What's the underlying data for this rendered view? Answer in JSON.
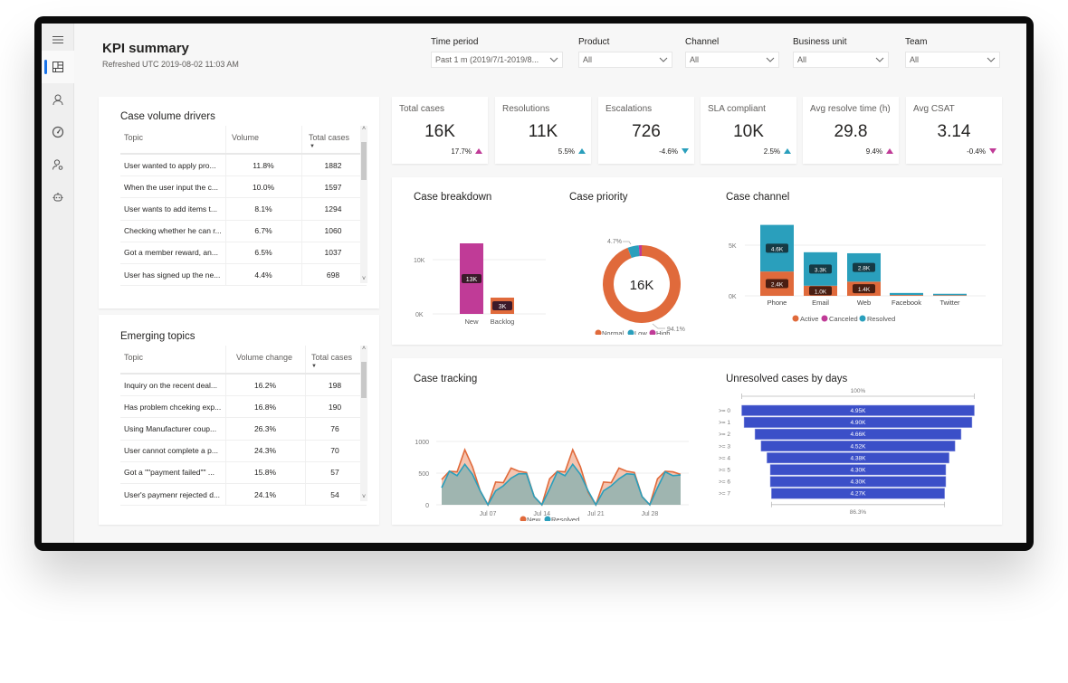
{
  "header": {
    "title": "KPI summary",
    "refreshed": "Refreshed UTC 2019-08-02 11:03 AM"
  },
  "sidebar": {
    "items": [
      {
        "name": "menu-icon",
        "active": false
      },
      {
        "name": "dashboard-icon",
        "active": true
      },
      {
        "name": "person-icon",
        "active": false
      },
      {
        "name": "gauge-icon",
        "active": false
      },
      {
        "name": "person-settings-icon",
        "active": false
      },
      {
        "name": "bot-icon",
        "active": false
      }
    ]
  },
  "filters": [
    {
      "label": "Time period",
      "value": "Past 1 m (2019/7/1-2019/8..."
    },
    {
      "label": "Product",
      "value": "All"
    },
    {
      "label": "Channel",
      "value": "All"
    },
    {
      "label": "Business unit",
      "value": "All"
    },
    {
      "label": "Team",
      "value": "All"
    }
  ],
  "case_volume_drivers": {
    "title": "Case volume drivers",
    "columns": [
      "Topic",
      "Volume",
      "Total cases"
    ],
    "rows": [
      [
        "User wanted to apply pro...",
        "11.8%",
        "1882"
      ],
      [
        "When the user input the c...",
        "10.0%",
        "1597"
      ],
      [
        "User wants to add items t...",
        "8.1%",
        "1294"
      ],
      [
        "Checking whether he can r...",
        "6.7%",
        "1060"
      ],
      [
        "Got a member reward, an...",
        "6.5%",
        "1037"
      ],
      [
        "User has signed up the ne...",
        "4.4%",
        "698"
      ]
    ]
  },
  "emerging_topics": {
    "title": "Emerging topics",
    "columns": [
      "Topic",
      "Volume change",
      "Total cases"
    ],
    "rows": [
      [
        "Inquiry on the recent deal...",
        "16.2%",
        "198"
      ],
      [
        "Has problem chceking exp...",
        "16.8%",
        "190"
      ],
      [
        "Using Manufacturer coup...",
        "26.3%",
        "76"
      ],
      [
        "User cannot complete a p...",
        "24.3%",
        "70"
      ],
      [
        "Got a \"\"payment failed\"\" ...",
        "15.8%",
        "57"
      ],
      [
        "User's paymenr rejected d...",
        "24.1%",
        "54"
      ]
    ]
  },
  "kpis": [
    {
      "label": "Total cases",
      "value": "16K",
      "change": "17.7%",
      "direction": "up",
      "color": "#c03b97"
    },
    {
      "label": "Resolutions",
      "value": "11K",
      "change": "5.5%",
      "direction": "up",
      "color": "#2a9fbc"
    },
    {
      "label": "Escalations",
      "value": "726",
      "change": "-4.6%",
      "direction": "down",
      "color": "#2a9fbc"
    },
    {
      "label": "SLA compliant",
      "value": "10K",
      "change": "2.5%",
      "direction": "up",
      "color": "#2a9fbc"
    },
    {
      "label": "Avg resolve time (h)",
      "value": "29.8",
      "change": "9.4%",
      "direction": "up",
      "color": "#c03b97"
    },
    {
      "label": "Avg CSAT",
      "value": "3.14",
      "change": "-0.4%",
      "direction": "down",
      "color": "#c03b97"
    }
  ],
  "colors": {
    "orange": "#e06a3b",
    "teal": "#2a9fbc",
    "magenta": "#c03b97",
    "funnel": "#3b4fc8",
    "area_fill": "#9fb5b0",
    "new_fill": "#f4c4b0",
    "label_dark": "#3b1a2a"
  },
  "chart_data": [
    {
      "id": "case_breakdown",
      "type": "bar",
      "title": "Case breakdown",
      "categories": [
        "New",
        "Backlog"
      ],
      "values": [
        13000,
        3000
      ],
      "data_labels": [
        "13K",
        "3K"
      ],
      "bar_colors": [
        "#c03b97",
        "#e06a3b"
      ],
      "yticks": [
        "0K",
        "10K"
      ],
      "ylim": [
        0,
        15000
      ],
      "grid": true
    },
    {
      "id": "case_priority",
      "type": "pie",
      "title": "Case priority",
      "center_label": "16K",
      "labels": [
        "Normal",
        "Low",
        "High"
      ],
      "values": [
        94.1,
        4.7,
        1.2
      ],
      "colors": [
        "#e06a3b",
        "#2a9fbc",
        "#c03b97"
      ],
      "data_labels": [
        "94.1%",
        "4.7%"
      ],
      "legend": "bottom"
    },
    {
      "id": "case_channel",
      "type": "bar",
      "stacked": true,
      "title": "Case channel",
      "categories": [
        "Phone",
        "Email",
        "Web",
        "Facebook",
        "Twitter"
      ],
      "series": [
        {
          "name": "Active",
          "color": "#e06a3b",
          "values": [
            2400,
            1000,
            1400,
            80,
            60
          ],
          "labels": [
            "2.4K",
            "1.0K",
            "1.4K",
            "",
            ""
          ]
        },
        {
          "name": "Canceled",
          "color": "#c03b97",
          "values": [
            0,
            0,
            0,
            0,
            0
          ],
          "labels": [
            "",
            "",
            "",
            "",
            ""
          ]
        },
        {
          "name": "Resolved",
          "color": "#2a9fbc",
          "values": [
            4600,
            3300,
            2800,
            200,
            140
          ],
          "labels": [
            "4.6K",
            "3.3K",
            "2.8K",
            "",
            ""
          ]
        }
      ],
      "yticks": [
        "0K",
        "5K"
      ],
      "ylim": [
        0,
        7500
      ],
      "legend": "bottom",
      "grid": true
    },
    {
      "id": "case_tracking",
      "type": "area",
      "title": "Case tracking",
      "x_start": "Jul 01",
      "xticks": [
        "Jul 07",
        "Jul 14",
        "Jul 21",
        "Jul 28"
      ],
      "xtick_index": [
        6,
        13,
        20,
        27
      ],
      "yticks": [
        "0",
        "500",
        "1000"
      ],
      "ylim": [
        0,
        1000
      ],
      "series": [
        {
          "name": "New",
          "color": "#e06a3b",
          "values": [
            400,
            530,
            520,
            870,
            600,
            220,
            0,
            360,
            350,
            580,
            530,
            510,
            130,
            0,
            410,
            530,
            520,
            870,
            600,
            200,
            0,
            360,
            350,
            580,
            530,
            510,
            130,
            0,
            410,
            530,
            520,
            480
          ]
        },
        {
          "name": "Resolved",
          "color": "#2a9fbc",
          "values": [
            270,
            530,
            460,
            640,
            480,
            220,
            0,
            220,
            300,
            420,
            490,
            490,
            130,
            0,
            250,
            520,
            460,
            640,
            480,
            220,
            0,
            220,
            300,
            410,
            490,
            480,
            130,
            0,
            270,
            520,
            460,
            470
          ]
        }
      ],
      "legend": "bottom",
      "grid": true
    },
    {
      "id": "unresolved_by_days",
      "type": "bar",
      "subtype": "funnel",
      "title": "Unresolved cases by days",
      "categories": [
        ">= 0",
        ">= 1",
        ">= 2",
        ">= 3",
        ">= 4",
        ">= 5",
        ">= 6",
        ">= 7"
      ],
      "values": [
        4950,
        4900,
        4660,
        4520,
        4380,
        4300,
        4300,
        4270
      ],
      "data_labels": [
        "4.95K",
        "4.90K",
        "4.66K",
        "4.52K",
        "4.38K",
        "4.30K",
        "4.30K",
        "4.27K"
      ],
      "top_label": "100%",
      "bottom_label": "86.3%",
      "color": "#3b4fc8"
    }
  ]
}
